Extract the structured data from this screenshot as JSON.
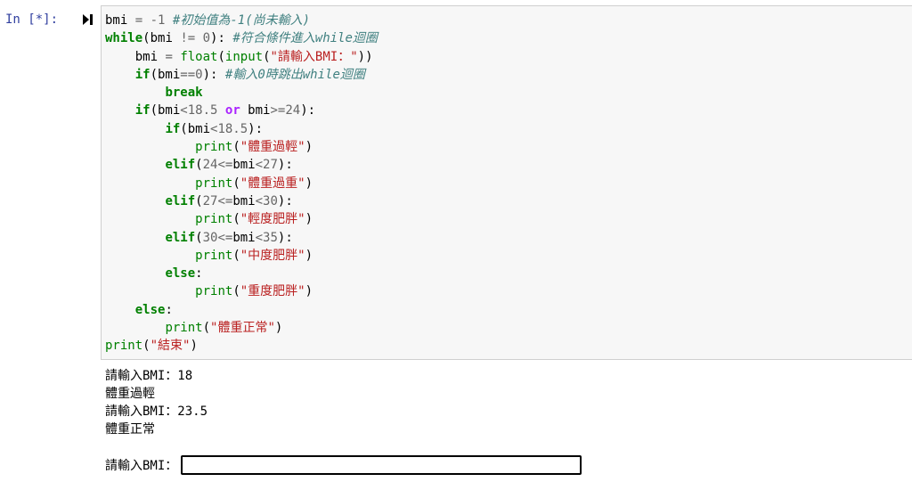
{
  "cell": {
    "prompt": "In [*]:",
    "code_lines": [
      [
        [
          "t",
          "bmi "
        ],
        [
          "op",
          "="
        ],
        [
          "t",
          " "
        ],
        [
          "op",
          "-"
        ],
        [
          "num",
          "1"
        ],
        [
          "t",
          " "
        ],
        [
          "cmt",
          "#初始值為-1(尚未輸入)"
        ]
      ],
      [
        [
          "kw",
          "while"
        ],
        [
          "t",
          "(bmi "
        ],
        [
          "op",
          "!="
        ],
        [
          "t",
          " "
        ],
        [
          "num",
          "0"
        ],
        [
          "t",
          "): "
        ],
        [
          "cmt",
          "#符合條件進入while迴圈"
        ]
      ],
      [
        [
          "t",
          "    bmi "
        ],
        [
          "op",
          "="
        ],
        [
          "t",
          " "
        ],
        [
          "bi",
          "float"
        ],
        [
          "t",
          "("
        ],
        [
          "bi",
          "input"
        ],
        [
          "t",
          "("
        ],
        [
          "str",
          "\"請輸入BMI：\""
        ],
        [
          "t",
          "))"
        ]
      ],
      [
        [
          "t",
          "    "
        ],
        [
          "kw",
          "if"
        ],
        [
          "t",
          "(bmi"
        ],
        [
          "op",
          "=="
        ],
        [
          "num",
          "0"
        ],
        [
          "t",
          "): "
        ],
        [
          "cmt",
          "#輸入0時跳出while迴圈"
        ]
      ],
      [
        [
          "t",
          "        "
        ],
        [
          "kw",
          "break"
        ]
      ],
      [
        [
          "t",
          "    "
        ],
        [
          "kw",
          "if"
        ],
        [
          "t",
          "(bmi"
        ],
        [
          "op",
          "<"
        ],
        [
          "num",
          "18.5"
        ],
        [
          "t",
          " "
        ],
        [
          "opw",
          "or"
        ],
        [
          "t",
          " bmi"
        ],
        [
          "op",
          ">="
        ],
        [
          "num",
          "24"
        ],
        [
          "t",
          "):"
        ]
      ],
      [
        [
          "t",
          "        "
        ],
        [
          "kw",
          "if"
        ],
        [
          "t",
          "(bmi"
        ],
        [
          "op",
          "<"
        ],
        [
          "num",
          "18.5"
        ],
        [
          "t",
          "):"
        ]
      ],
      [
        [
          "t",
          "            "
        ],
        [
          "bi",
          "print"
        ],
        [
          "t",
          "("
        ],
        [
          "str",
          "\"體重過輕\""
        ],
        [
          "t",
          ")"
        ]
      ],
      [
        [
          "t",
          "        "
        ],
        [
          "kw",
          "elif"
        ],
        [
          "t",
          "("
        ],
        [
          "num",
          "24"
        ],
        [
          "op",
          "<="
        ],
        [
          "t",
          "bmi"
        ],
        [
          "op",
          "<"
        ],
        [
          "num",
          "27"
        ],
        [
          "t",
          "):"
        ]
      ],
      [
        [
          "t",
          "            "
        ],
        [
          "bi",
          "print"
        ],
        [
          "t",
          "("
        ],
        [
          "str",
          "\"體重過重\""
        ],
        [
          "t",
          ")"
        ]
      ],
      [
        [
          "t",
          "        "
        ],
        [
          "kw",
          "elif"
        ],
        [
          "t",
          "("
        ],
        [
          "num",
          "27"
        ],
        [
          "op",
          "<="
        ],
        [
          "t",
          "bmi"
        ],
        [
          "op",
          "<"
        ],
        [
          "num",
          "30"
        ],
        [
          "t",
          "):"
        ]
      ],
      [
        [
          "t",
          "            "
        ],
        [
          "bi",
          "print"
        ],
        [
          "t",
          "("
        ],
        [
          "str",
          "\"輕度肥胖\""
        ],
        [
          "t",
          ")"
        ]
      ],
      [
        [
          "t",
          "        "
        ],
        [
          "kw",
          "elif"
        ],
        [
          "t",
          "("
        ],
        [
          "num",
          "30"
        ],
        [
          "op",
          "<="
        ],
        [
          "t",
          "bmi"
        ],
        [
          "op",
          "<"
        ],
        [
          "num",
          "35"
        ],
        [
          "t",
          "):"
        ]
      ],
      [
        [
          "t",
          "            "
        ],
        [
          "bi",
          "print"
        ],
        [
          "t",
          "("
        ],
        [
          "str",
          "\"中度肥胖\""
        ],
        [
          "t",
          ")"
        ]
      ],
      [
        [
          "t",
          "        "
        ],
        [
          "kw",
          "else"
        ],
        [
          "t",
          ":"
        ]
      ],
      [
        [
          "t",
          "            "
        ],
        [
          "bi",
          "print"
        ],
        [
          "t",
          "("
        ],
        [
          "str",
          "\"重度肥胖\""
        ],
        [
          "t",
          ")"
        ]
      ],
      [
        [
          "t",
          "    "
        ],
        [
          "kw",
          "else"
        ],
        [
          "t",
          ":"
        ]
      ],
      [
        [
          "t",
          "        "
        ],
        [
          "bi",
          "print"
        ],
        [
          "t",
          "("
        ],
        [
          "str",
          "\"體重正常\""
        ],
        [
          "t",
          ")"
        ]
      ],
      [
        [
          "bi",
          "print"
        ],
        [
          "t",
          "("
        ],
        [
          "str",
          "\"結束\""
        ],
        [
          "t",
          ")"
        ]
      ]
    ],
    "output_lines": [
      "請輸入BMI：18",
      "體重過輕",
      "請輸入BMI：23.5",
      "體重正常"
    ],
    "stdin_prompt": "請輸入BMI：",
    "stdin_value": ""
  },
  "icons": {
    "run_marker": "run-marker-icon"
  }
}
